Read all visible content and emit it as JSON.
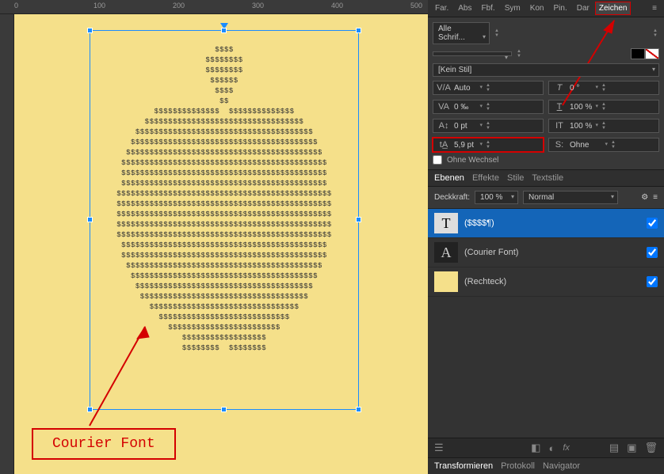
{
  "ruler": {
    "t0": "0",
    "t100": "100",
    "t200": "200",
    "t300": "300",
    "t400": "400",
    "t500": "500"
  },
  "ascii": "$$$$\n$$$$$$$$\n$$$$$$$$\n$$$$$$\n$$$$\n$$\n$$$$$$$$$$$$$$  $$$$$$$$$$$$$$\n$$$$$$$$$$$$$$$$$$$$$$$$$$$$$$$$$$\n$$$$$$$$$$$$$$$$$$$$$$$$$$$$$$$$$$$$$$\n$$$$$$$$$$$$$$$$$$$$$$$$$$$$$$$$$$$$$$$$\n$$$$$$$$$$$$$$$$$$$$$$$$$$$$$$$$$$$$$$$$$$\n$$$$$$$$$$$$$$$$$$$$$$$$$$$$$$$$$$$$$$$$$$$$\n$$$$$$$$$$$$$$$$$$$$$$$$$$$$$$$$$$$$$$$$$$$$\n$$$$$$$$$$$$$$$$$$$$$$$$$$$$$$$$$$$$$$$$$$$$\n$$$$$$$$$$$$$$$$$$$$$$$$$$$$$$$$$$$$$$$$$$$$$$\n$$$$$$$$$$$$$$$$$$$$$$$$$$$$$$$$$$$$$$$$$$$$$$\n$$$$$$$$$$$$$$$$$$$$$$$$$$$$$$$$$$$$$$$$$$$$$$\n$$$$$$$$$$$$$$$$$$$$$$$$$$$$$$$$$$$$$$$$$$$$$$\n$$$$$$$$$$$$$$$$$$$$$$$$$$$$$$$$$$$$$$$$$$$$$$\n$$$$$$$$$$$$$$$$$$$$$$$$$$$$$$$$$$$$$$$$$$$$\n$$$$$$$$$$$$$$$$$$$$$$$$$$$$$$$$$$$$$$$$$$$$\n$$$$$$$$$$$$$$$$$$$$$$$$$$$$$$$$$$$$$$$$$$\n$$$$$$$$$$$$$$$$$$$$$$$$$$$$$$$$$$$$$$$$\n$$$$$$$$$$$$$$$$$$$$$$$$$$$$$$$$$$$$$$\n$$$$$$$$$$$$$$$$$$$$$$$$$$$$$$$$$$$$\n$$$$$$$$$$$$$$$$$$$$$$$$$$$$$$$$\n$$$$$$$$$$$$$$$$$$$$$$$$$$$$\n$$$$$$$$$$$$$$$$$$$$$$$$\n$$$$$$$$$$$$$$$$$$\n$$$$$$$$  $$$$$$$$",
  "label": {
    "courier": "Courier Font"
  },
  "tabs": {
    "far": "Far.",
    "abs": "Abs",
    "fbf": "Fbf.",
    "sym": "Sym",
    "kon": "Kon",
    "pin": "Pin.",
    "dar": "Dar",
    "zeichen": "Zeichen"
  },
  "char": {
    "font": "Alle Schrif...",
    "nostyle": "[Kein Stil]",
    "kerning": "Auto",
    "tracking": "0 ‰",
    "baseline": "0 pt",
    "leading": "5,9 pt",
    "slant": "0 °",
    "hscale": "100 %",
    "vscale": "100 %",
    "lang": "Ohne",
    "nowechsel": "Ohne Wechsel"
  },
  "layers_panel": {
    "tabs": {
      "ebenen": "Ebenen",
      "effekte": "Effekte",
      "stile": "Stile",
      "textstile": "Textstile"
    },
    "opacity_label": "Deckkraft:",
    "opacity_value": "100 %",
    "blend": "Normal"
  },
  "layers": {
    "l0": {
      "name": "($$$$¶)"
    },
    "l1": {
      "name": "(Courier Font)"
    },
    "l2": {
      "name": "(Rechteck)"
    }
  },
  "bottom_tabs": {
    "transform": "Transformieren",
    "protokoll": "Protokoll",
    "navigator": "Navigator"
  }
}
